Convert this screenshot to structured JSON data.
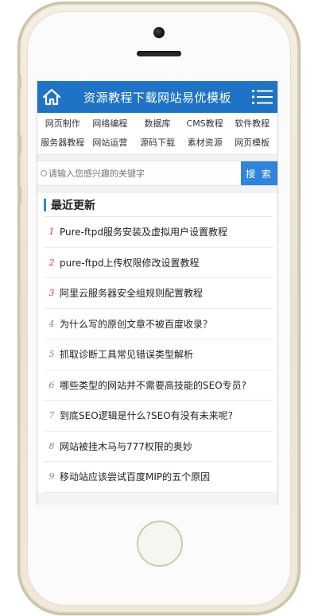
{
  "header": {
    "title": "资源教程下载网站易优模板",
    "home_icon": "home-icon",
    "menu_icon": "hamburger-menu-icon",
    "color": "#1f73c6"
  },
  "nav": {
    "items": [
      "网页制作",
      "网络编程",
      "数据库",
      "CMS教程",
      "软件教程",
      "服务器教程",
      "网站运营",
      "源码下载",
      "素材资源",
      "网页模板"
    ]
  },
  "search": {
    "placeholder": "请输入您感兴趣的关键字",
    "button_label": "搜 索",
    "button_color": "#2f84dc"
  },
  "recent": {
    "title": "最近更新",
    "items": [
      {
        "rank": "1",
        "title": "Pure-ftpd服务安装及虚拟用户设置教程"
      },
      {
        "rank": "2",
        "title": "pure-ftpd上传权限修改设置教程"
      },
      {
        "rank": "3",
        "title": "阿里云服务器安全组规则配置教程"
      },
      {
        "rank": "4",
        "title": "为什么写的原创文章不被百度收录？"
      },
      {
        "rank": "5",
        "title": "抓取诊断工具常见错误类型解析"
      },
      {
        "rank": "6",
        "title": "哪些类型的网站并不需要高技能的SEO专员?"
      },
      {
        "rank": "7",
        "title": "到底SEO逻辑是什么?SEO有没有未来呢?"
      },
      {
        "rank": "8",
        "title": "网站被挂木马与777权限的奥妙"
      },
      {
        "rank": "9",
        "title": "移动站应该尝试百度MIP的五个原因"
      }
    ],
    "hot_color": "#d93636"
  }
}
